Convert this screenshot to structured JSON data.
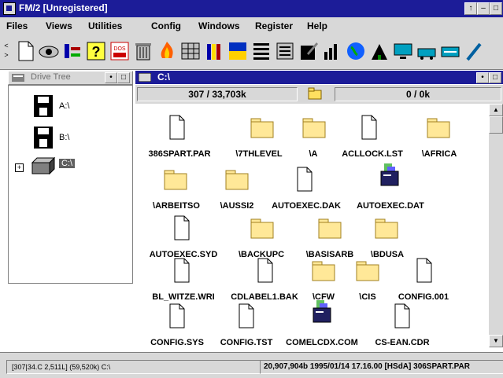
{
  "window": {
    "title": "FM/2  [Unregistered]",
    "controls": [
      "↑",
      "–",
      "□"
    ]
  },
  "menu": [
    "Files",
    "Views",
    "Utilities",
    "Config",
    "Windows",
    "Register",
    "Help"
  ],
  "toolbar": {
    "scroll_arrows": [
      "<",
      ">"
    ],
    "tools": [
      "new-file-icon",
      "view-icon",
      "tree-icon",
      "help-icon",
      "dos-icon",
      "trash-icon",
      "fire-icon",
      "grid-icon",
      "books-icon",
      "color-icon",
      "list-icon",
      "details-icon",
      "edit-icon",
      "chart-icon",
      "globe-icon",
      "tree2-icon",
      "monitor-icon",
      "network-icon"
    ]
  },
  "drive_tree": {
    "title": "Drive Tree",
    "drives": [
      {
        "label": "A:\\",
        "icon": "floppy-icon"
      },
      {
        "label": "B:\\",
        "icon": "floppy-icon"
      },
      {
        "label": "C:\\",
        "icon": "harddisk-icon",
        "expander": "+"
      }
    ]
  },
  "directory": {
    "title": "C:\\",
    "status_left": "307 / 33,703k",
    "status_right": "0 / 0k",
    "files": [
      {
        "name": "386SPART.PAR",
        "type": "file"
      },
      {
        "name": "\\7THLEVEL",
        "type": "folder"
      },
      {
        "name": "\\A",
        "type": "folder"
      },
      {
        "name": "ACLLOCK.LST",
        "type": "file"
      },
      {
        "name": "\\AFRICA",
        "type": "folder"
      },
      {
        "name": "\\ARBEITSO",
        "type": "folder"
      },
      {
        "name": "\\AUSSI2",
        "type": "folder"
      },
      {
        "name": "AUTOEXEC.DAK",
        "type": "file"
      },
      {
        "name": "AUTOEXEC.DAT",
        "type": "program"
      },
      {
        "name": "AUTOEXEC.SYD",
        "type": "file"
      },
      {
        "name": "\\BACKUPC",
        "type": "folder"
      },
      {
        "name": "\\BASISARB",
        "type": "folder"
      },
      {
        "name": "\\BDUSA",
        "type": "folder"
      },
      {
        "name": "BL_WITZE.WRI",
        "type": "file"
      },
      {
        "name": "CDLABEL1.BAK",
        "type": "file"
      },
      {
        "name": "\\CFW",
        "type": "folder"
      },
      {
        "name": "\\CIS",
        "type": "folder"
      },
      {
        "name": "CONFIG.001",
        "type": "file"
      },
      {
        "name": "CONFIG.SYS",
        "type": "file"
      },
      {
        "name": "CONFIG.TST",
        "type": "file"
      },
      {
        "name": "COMELCDX.COM",
        "type": "program"
      },
      {
        "name": "CS-EAN.CDR",
        "type": "file"
      }
    ]
  },
  "statusbar": {
    "left": "[307|34.C 2,511L] (59,520k) C:\\",
    "right": "20,907,904b  1995/01/14  17.16.00  [HSdA]  306SPART.PAR"
  }
}
